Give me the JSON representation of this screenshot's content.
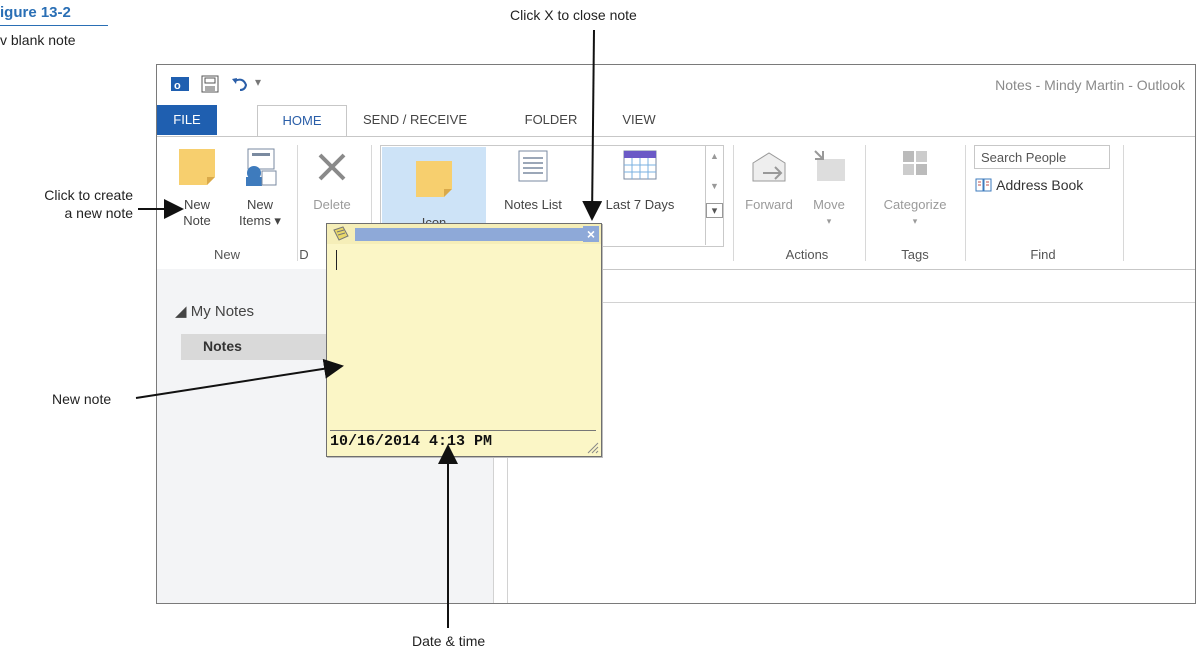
{
  "figure": {
    "title": "igure 13-2",
    "caption": "v blank note"
  },
  "callouts": {
    "close_note": "Click X to close note",
    "create_line1": "Click to create",
    "create_line2": "a new note",
    "new_note": "New note",
    "date_time": "Date & time"
  },
  "window": {
    "title": "Notes - Mindy Martin - Outlook"
  },
  "tabs": [
    "FILE",
    "HOME",
    "SEND / RECEIVE",
    "FOLDER",
    "VIEW"
  ],
  "ribbon": {
    "new_note": [
      "New",
      "Note"
    ],
    "new_items": [
      "New",
      "Items ▾"
    ],
    "delete": "Delete",
    "icon_view": "Icon",
    "notes_list": "Notes List",
    "last_7_days": "Last 7 Days",
    "forward": "Forward",
    "move": "Move",
    "categorize": "Categorize",
    "search_people": "Search People",
    "address_book": "Address Book",
    "groups": {
      "new": "New",
      "delete": "D",
      "actions": "Actions",
      "tags": "Tags",
      "find": "Find"
    }
  },
  "nav": {
    "header": "◢ My Notes",
    "selected": "Notes"
  },
  "note": {
    "datetime": "10/16/2014 4:13 PM",
    "close_glyph": "×"
  },
  "icons": [
    "outlook-app-icon",
    "save-icon",
    "undo-icon",
    "sticky-note-icon",
    "new-items-icon",
    "delete-x-icon",
    "notes-list-icon",
    "calendar-icon",
    "forward-envelope-icon",
    "move-folder-icon",
    "categorize-grid-icon",
    "address-book-icon"
  ]
}
